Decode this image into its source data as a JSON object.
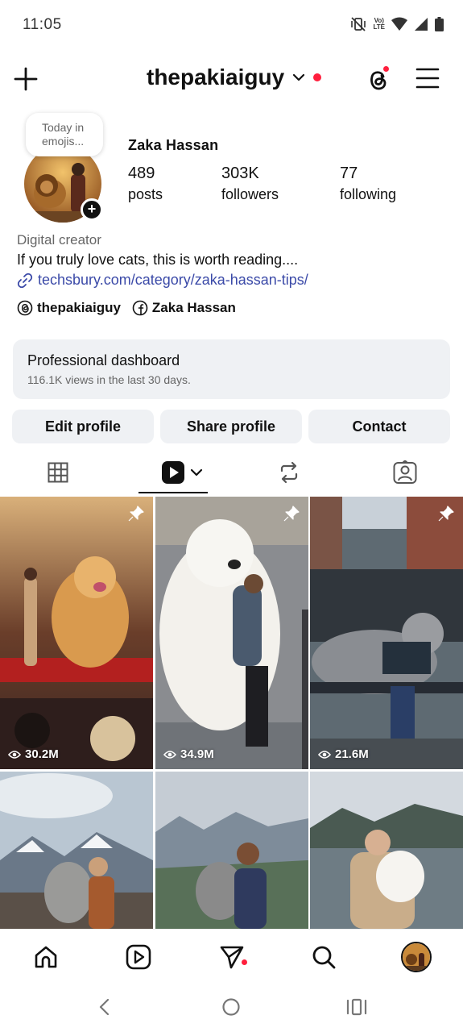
{
  "status_bar": {
    "time": "11:05",
    "network_label": "Vo) LTE",
    "icons": [
      "mute-vibrate-icon",
      "volte-icon",
      "wifi-icon",
      "signal-icon",
      "battery-icon"
    ]
  },
  "top_bar": {
    "username": "thepakiaiguy",
    "icons": [
      "plus-icon",
      "chevron-down-icon",
      "threads-icon",
      "menu-icon"
    ],
    "accent_dot_color": "#ff1f3d"
  },
  "profile": {
    "note": "Today in emojis...",
    "display_name": "Zaka Hassan",
    "stats": [
      {
        "value": "489",
        "label": "posts"
      },
      {
        "value": "303K",
        "label": "followers"
      },
      {
        "value": "77",
        "label": "following"
      }
    ],
    "category": "Digital creator",
    "bio": "If you truly love cats, this is worth reading....",
    "link": "techsbury.com/category/zaka-hassan-tips/",
    "link_color": "#3b4aa8",
    "threads_handle": "thepakiaiguy",
    "facebook_name": "Zaka Hassan"
  },
  "dashboard": {
    "title": "Professional dashboard",
    "subtitle": "116.1K views in the last 30 days."
  },
  "buttons": {
    "edit": "Edit profile",
    "share": "Share profile",
    "contact": "Contact"
  },
  "tabs": [
    {
      "name": "grid-icon",
      "active": false
    },
    {
      "name": "reels-icon",
      "active": true
    },
    {
      "name": "reposts-icon",
      "active": false
    },
    {
      "name": "tagged-icon",
      "active": false
    }
  ],
  "posts": [
    {
      "views": "30.2M",
      "pinned": true,
      "scene": "golden dog with woman on red carpet"
    },
    {
      "views": "34.9M",
      "pinned": true,
      "scene": "giant white dog hugged by woman"
    },
    {
      "views": "21.6M",
      "pinned": true,
      "scene": "giant grey cat with man on bench"
    },
    {
      "views": "",
      "pinned": false,
      "scene": "woman holding cat on mountain"
    },
    {
      "views": "",
      "pinned": false,
      "scene": "woman hugging cat in valley"
    },
    {
      "views": "",
      "pinned": false,
      "scene": "woman holding white cat by lake"
    }
  ],
  "bottom_nav": [
    "home-icon",
    "reels-icon",
    "send-icon",
    "search-icon",
    "profile-avatar"
  ],
  "system_nav": [
    "back-icon",
    "home-circle-icon",
    "recents-icon"
  ]
}
